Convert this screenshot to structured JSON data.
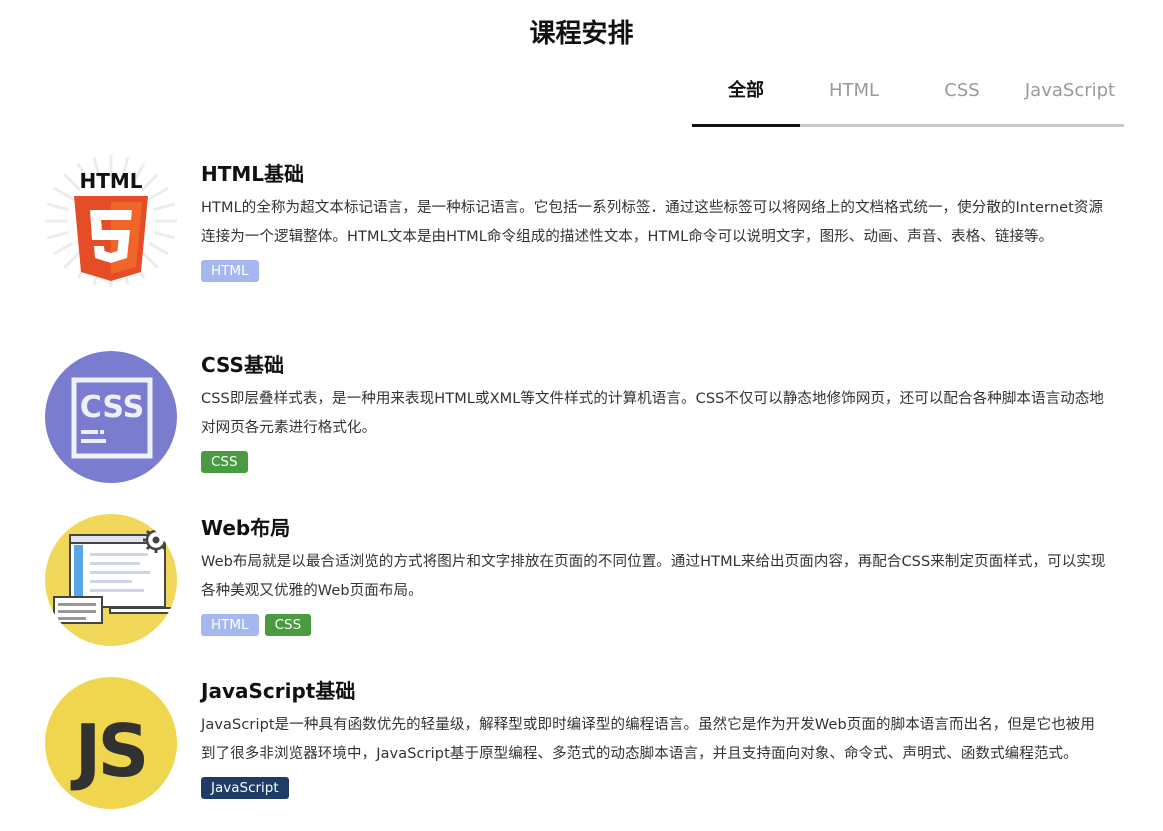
{
  "page": {
    "title": "课程安排"
  },
  "tabs": [
    {
      "label": "全部",
      "active": true
    },
    {
      "label": "HTML",
      "active": false
    },
    {
      "label": "CSS",
      "active": false
    },
    {
      "label": "JavaScript",
      "active": false
    }
  ],
  "courses": [
    {
      "name": "HTML基础",
      "icon": "html5-logo-icon",
      "description": "HTML的全称为超文本标记语言，是一种标记语言。它包括一系列标签．通过这些标签可以将网络上的文档格式统一，使分散的Internet资源连接为一个逻辑整体。HTML文本是由HTML命令组成的描述性文本，HTML命令可以说明文字，图形、动画、声音、表格、链接等。",
      "tags": [
        {
          "label": "HTML",
          "kind": "html"
        }
      ]
    },
    {
      "name": "CSS基础",
      "icon": "css-logo-icon",
      "description": "CSS即层叠样式表，是一种用来表现HTML或XML等文件样式的计算机语言。CSS不仅可以静态地修饰网页，还可以配合各种脚本语言动态地对网页各元素进行格式化。",
      "tags": [
        {
          "label": "CSS",
          "kind": "css"
        }
      ]
    },
    {
      "name": "Web布局",
      "icon": "web-layout-icon",
      "description": "Web布局就是以最合适浏览的方式将图片和文字排放在页面的不同位置。通过HTML来给出页面内容，再配合CSS来制定页面样式，可以实现各种美观又优雅的Web页面布局。",
      "tags": [
        {
          "label": "HTML",
          "kind": "html"
        },
        {
          "label": "CSS",
          "kind": "css"
        }
      ]
    },
    {
      "name": "JavaScript基础",
      "icon": "javascript-logo-icon",
      "description": "JavaScript是一种具有函数优先的轻量级，解释型或即时编译型的编程语言。虽然它是作为开发Web页面的脚本语言而出名，但是它也被用到了很多非浏览器环境中，JavaScript基于原型编程、多范式的动态脚本语言，并且支持面向对象、命令式、声明式、函数式编程范式。",
      "tags": [
        {
          "label": "JavaScript",
          "kind": "js"
        }
      ]
    }
  ],
  "colors": {
    "html_tag": "#a4b7ef",
    "css_tag": "#4a9a42",
    "js_tag": "#1e3c66",
    "css_icon_bg": "#7a7ccf",
    "js_icon_bg": "#f0d64f",
    "web_icon_bg": "#f1d75a",
    "html5_orange": "#e44d26"
  }
}
